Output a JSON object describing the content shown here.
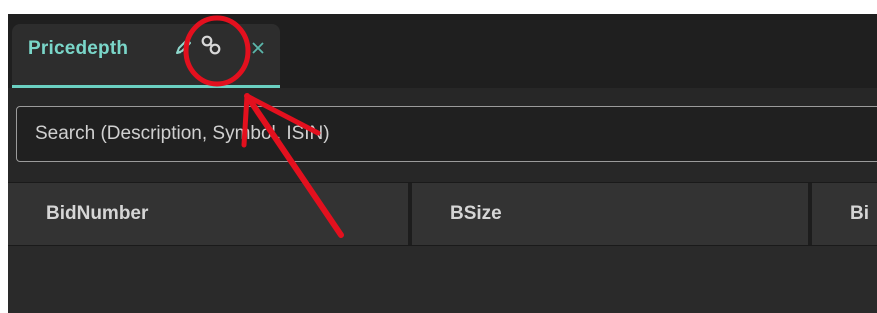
{
  "tab": {
    "title": "Pricedepth",
    "accent_color": "#6bd0c2",
    "icons": [
      "pencil-icon",
      "link-icon",
      "close-icon"
    ]
  },
  "search": {
    "placeholder": "Search (Description, Symbol, ISIN)"
  },
  "table": {
    "columns": [
      "BidNumber",
      "BSize",
      "Bi"
    ]
  },
  "annotation": {
    "color": "#e3101e",
    "shapes": [
      "circle",
      "arrow"
    ]
  }
}
